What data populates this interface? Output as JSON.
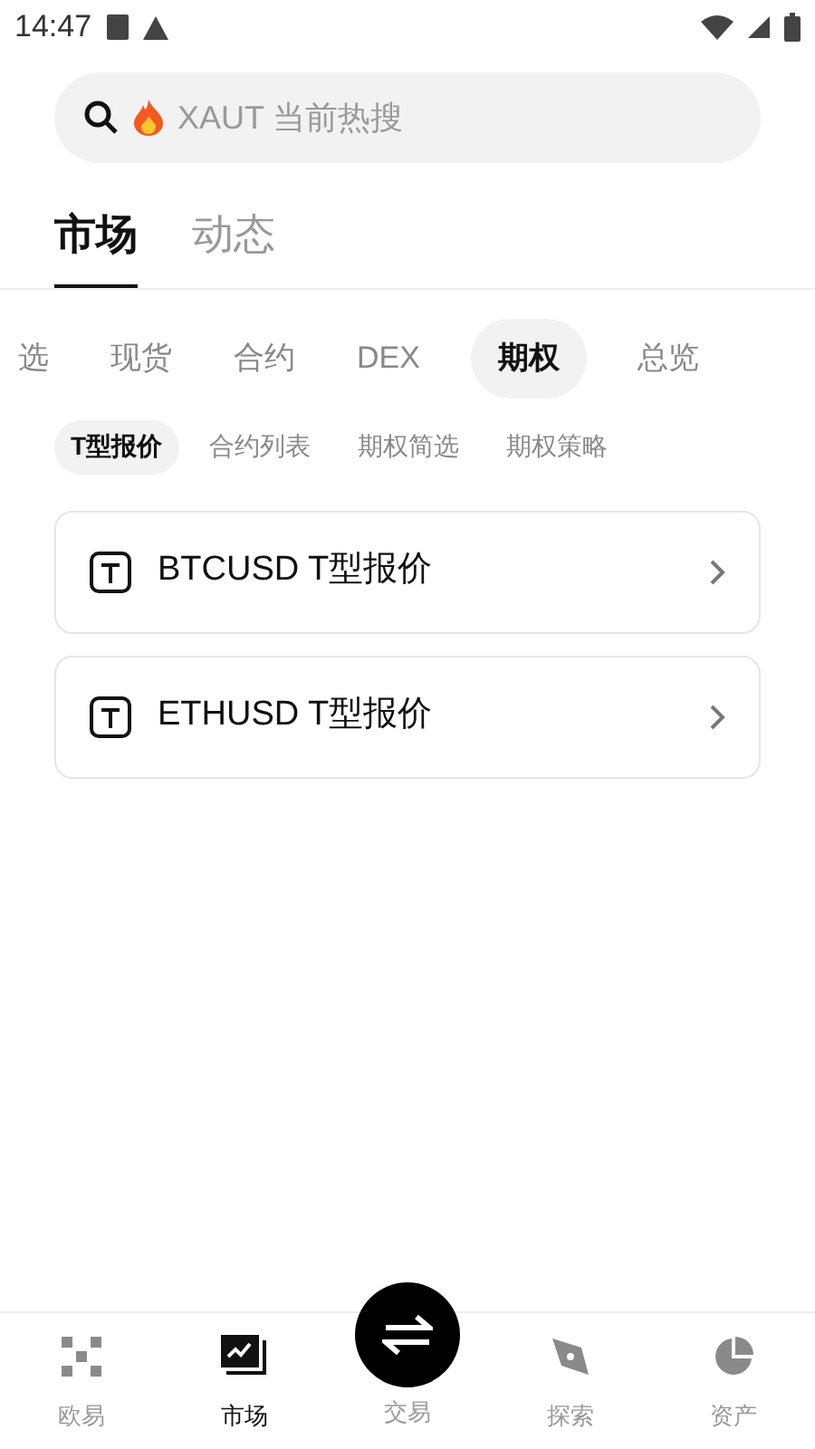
{
  "status_bar": {
    "time": "14:47"
  },
  "search": {
    "placeholder": "XAUT 当前热搜"
  },
  "main_tabs": [
    {
      "label": "市场",
      "selected": true
    },
    {
      "label": "动态",
      "selected": false
    }
  ],
  "category_tabs": [
    {
      "label": "选",
      "selected": false
    },
    {
      "label": "现货",
      "selected": false
    },
    {
      "label": "合约",
      "selected": false
    },
    {
      "label": "DEX",
      "selected": false
    },
    {
      "label": "期权",
      "selected": true
    },
    {
      "label": "总览",
      "selected": false
    }
  ],
  "sub_tabs": [
    {
      "label": "T型报价",
      "selected": true
    },
    {
      "label": "合约列表",
      "selected": false
    },
    {
      "label": "期权简选",
      "selected": false
    },
    {
      "label": "期权策略",
      "selected": false
    }
  ],
  "items": [
    {
      "label": "BTCUSD T型报价"
    },
    {
      "label": "ETHUSD T型报价"
    }
  ],
  "bottom_nav": [
    {
      "kind": "home",
      "label": "欧易",
      "selected": false
    },
    {
      "kind": "market",
      "label": "市场",
      "selected": true
    },
    {
      "kind": "trade",
      "label": "交易",
      "selected": false
    },
    {
      "kind": "explore",
      "label": "探索",
      "selected": false
    },
    {
      "kind": "assets",
      "label": "资产",
      "selected": false
    }
  ]
}
